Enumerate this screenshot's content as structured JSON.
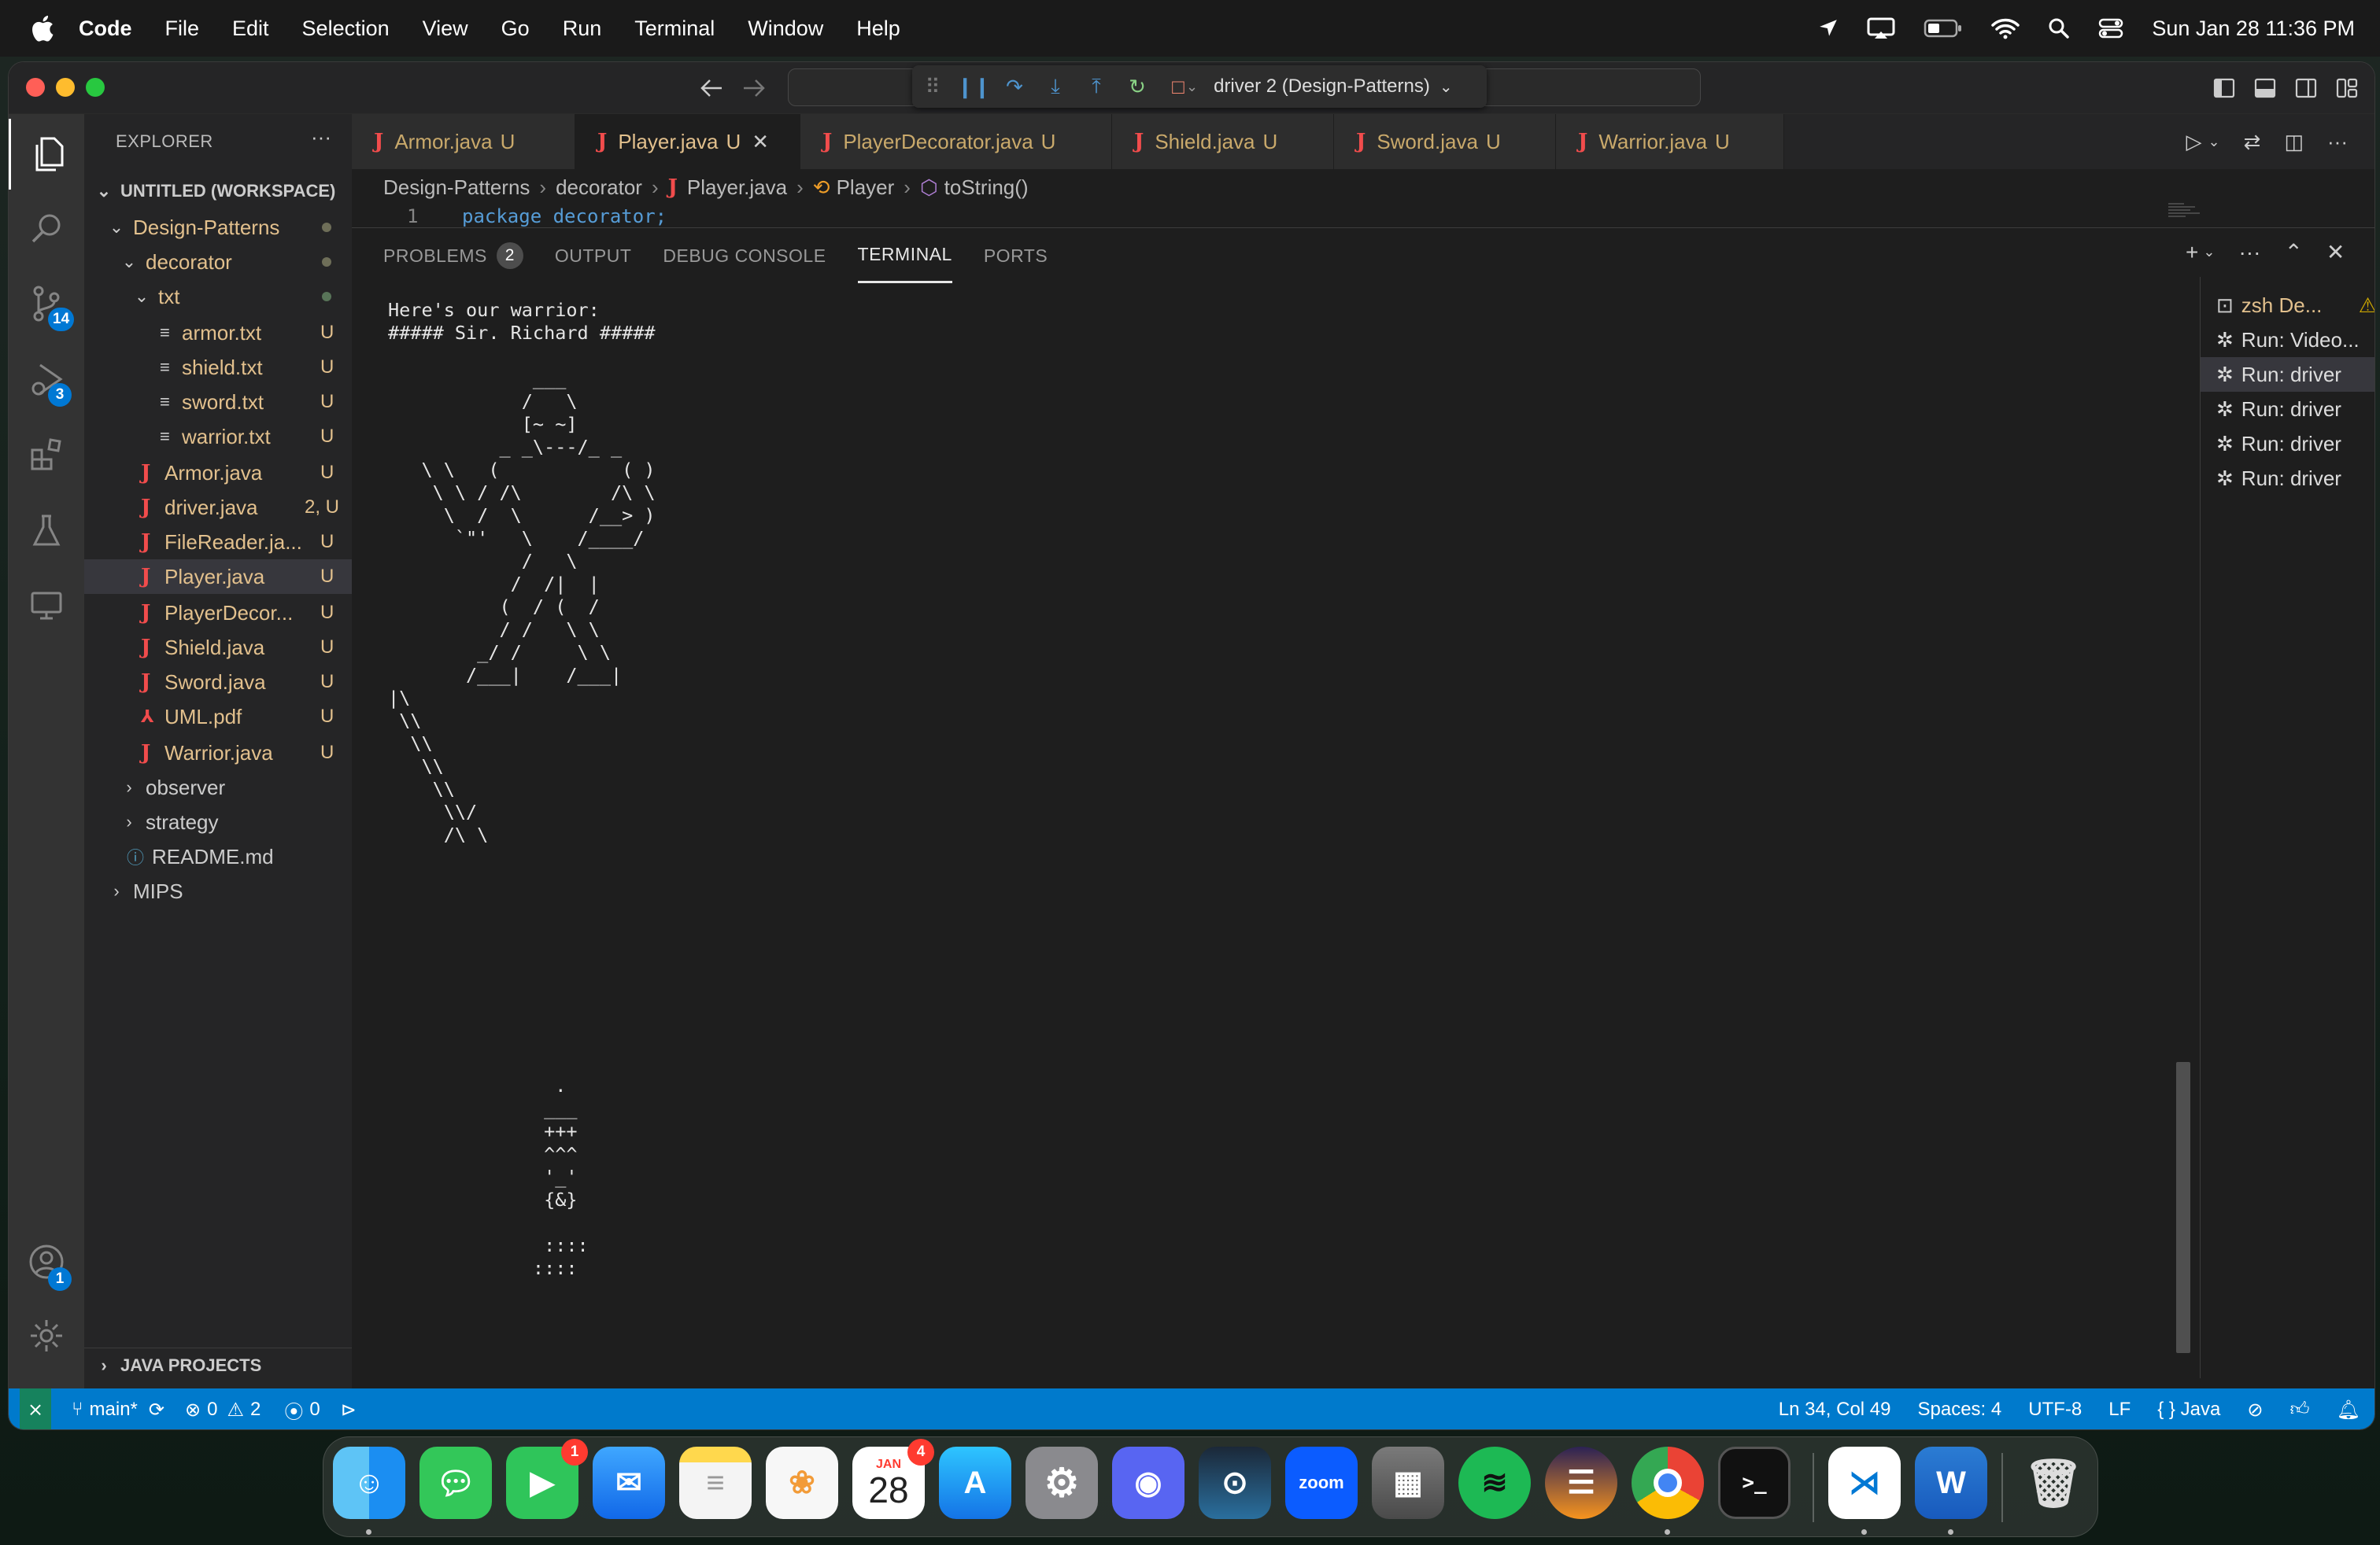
{
  "menubar": {
    "app": "Code",
    "items": [
      "File",
      "Edit",
      "Selection",
      "View",
      "Go",
      "Run",
      "Terminal",
      "Window",
      "Help"
    ],
    "clock": "Sun Jan 28  11:36 PM"
  },
  "titlebar": {
    "debug_session": "driver 2 (Design-Patterns)"
  },
  "activity": {
    "scm_badge": "14",
    "debug_badge": "3",
    "accounts_badge": "1"
  },
  "sidebar": {
    "title": "EXPLORER",
    "more": "···",
    "workspace": "UNTITLED (WORKSPACE)",
    "rows": [
      {
        "label": "Design-Patterns",
        "deco": ""
      },
      {
        "label": "decorator",
        "deco": ""
      },
      {
        "label": "txt",
        "deco": ""
      },
      {
        "label": "armor.txt",
        "deco": "U"
      },
      {
        "label": "shield.txt",
        "deco": "U"
      },
      {
        "label": "sword.txt",
        "deco": "U"
      },
      {
        "label": "warrior.txt",
        "deco": "U"
      },
      {
        "label": "Armor.java",
        "deco": "U"
      },
      {
        "label": "driver.java",
        "deco": "2, U"
      },
      {
        "label": "FileReader.ja...",
        "deco": "U"
      },
      {
        "label": "Player.java",
        "deco": "U"
      },
      {
        "label": "PlayerDecor...",
        "deco": "U"
      },
      {
        "label": "Shield.java",
        "deco": "U"
      },
      {
        "label": "Sword.java",
        "deco": "U"
      },
      {
        "label": "UML.pdf",
        "deco": "U"
      },
      {
        "label": "Warrior.java",
        "deco": "U"
      },
      {
        "label": "observer",
        "deco": ""
      },
      {
        "label": "strategy",
        "deco": ""
      },
      {
        "label": "README.md",
        "deco": ""
      },
      {
        "label": "MIPS",
        "deco": ""
      }
    ],
    "java_projects": "JAVA PROJECTS"
  },
  "tabs": [
    {
      "name": "Armor.java",
      "status": "U"
    },
    {
      "name": "Player.java",
      "status": "U"
    },
    {
      "name": "PlayerDecorator.java",
      "status": "U"
    },
    {
      "name": "Shield.java",
      "status": "U"
    },
    {
      "name": "Sword.java",
      "status": "U"
    },
    {
      "name": "Warrior.java",
      "status": "U"
    }
  ],
  "breadcrumbs": {
    "c1": "Design-Patterns",
    "c2": "decorator",
    "c3": "Player.java",
    "c4": "Player",
    "c5": "toString()"
  },
  "editor": {
    "line_number": "1",
    "code": "package decorator;"
  },
  "panel": {
    "tabs": [
      "PROBLEMS",
      "OUTPUT",
      "DEBUG CONSOLE",
      "TERMINAL",
      "PORTS"
    ],
    "problems_count": "2",
    "terminal_output": "Here's our warrior:\n##### Sir. Richard #####\n\n             ___\n            /   \\\n            [~ ~]\n          _ _\\---/_ _\n   \\ \\   (           ( )\n    \\ \\ / /\\        /\\ \\\n     \\  /  \\      /__> )\n      `\"'   \\    /____/\n            /   \\\n           /  /|  |\n          (  / (  /\n          / /   \\ \\\n        _/ /     \\ \\\n       /___|    /___|\n|\\\n \\\\\n  \\\\\n   \\\\\n    \\\\\n     \\\\/\n     /\\ \\\n\n\n\n\n\n\n\n\n\n\n               .\n              ___\n              +++\n              ^^^\n              '_'\n              {&}\n\n              ::::\n             ::::",
    "terminals": [
      {
        "label": "zsh  De..."
      },
      {
        "label": "Run: Video..."
      },
      {
        "label": "Run: driver"
      },
      {
        "label": "Run: driver"
      },
      {
        "label": "Run: driver"
      },
      {
        "label": "Run: driver"
      }
    ]
  },
  "status": {
    "branch": "main*",
    "errors": "0",
    "warnings": "2",
    "ports": "0",
    "position": "Ln 34, Col 49",
    "spaces": "Spaces: 4",
    "encoding": "UTF-8",
    "eol": "LF",
    "language": "Java"
  },
  "dock": {
    "facetime_badge": "1",
    "calendar_month": "JAN",
    "calendar_day": "28",
    "calendar_badge": "4",
    "zoom_label": "zoom",
    "word_label": "W"
  },
  "colors": {
    "accent": "#007acc",
    "modified": "#e2c08d",
    "java_icon": "#f14c4c"
  }
}
